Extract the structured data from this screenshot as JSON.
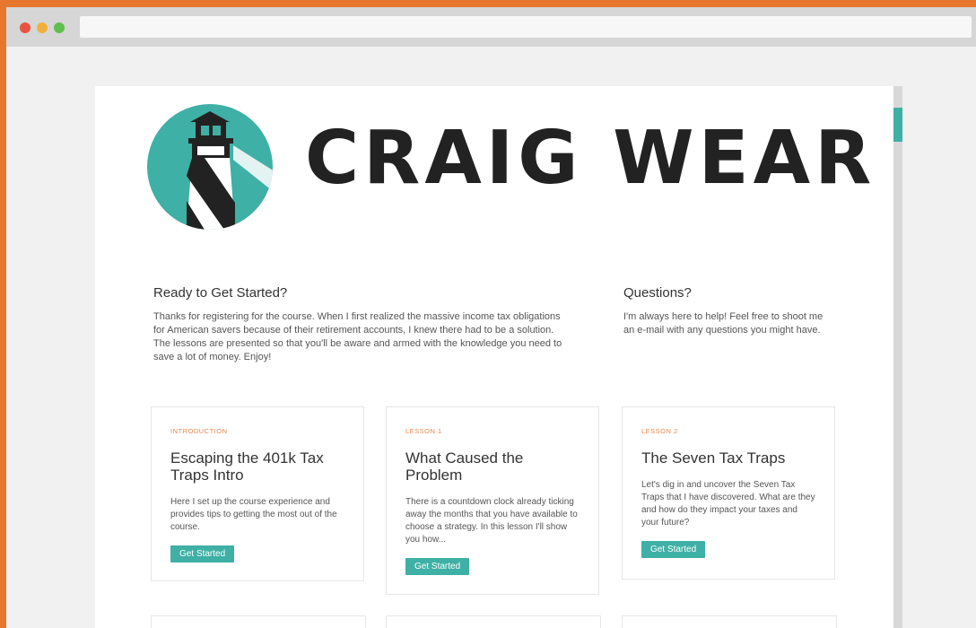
{
  "brand": {
    "name": "CRAIG WEAR"
  },
  "intro": {
    "title": "Ready to Get Started?",
    "text": "Thanks for registering for the course. When I first realized the massive income tax obligations for American savers because of their retirement accounts, I knew there had to be a solution. The lessons are presented so that you'll be aware and armed with the knowledge you need to save a lot of money. Enjoy!"
  },
  "questions": {
    "title": "Questions?",
    "text": "I'm always here to help! Feel free to shoot me an e-mail with any questions you might have."
  },
  "cards": [
    {
      "label": "INTRODUCTION",
      "title": "Escaping the 401k Tax Traps Intro",
      "text": "Here I set up the course experience and provides tips to getting the most out of the course.",
      "button": "Get Started"
    },
    {
      "label": "LESSON 1",
      "title": "What Caused the Problem",
      "text": "There is a countdown clock already ticking away the months that you have available to choose a strategy. In this lesson I'll show you how...",
      "button": "Get Started"
    },
    {
      "label": "LESSON 2",
      "title": "The Seven Tax Traps",
      "text": "Let's dig in and uncover the Seven Tax Traps that I have discovered. What are they and how do they impact your taxes and your future?",
      "button": "Get Started"
    }
  ],
  "colors": {
    "frame": "#e8772e",
    "accent": "#3eb0a5",
    "label": "#e8864a"
  }
}
